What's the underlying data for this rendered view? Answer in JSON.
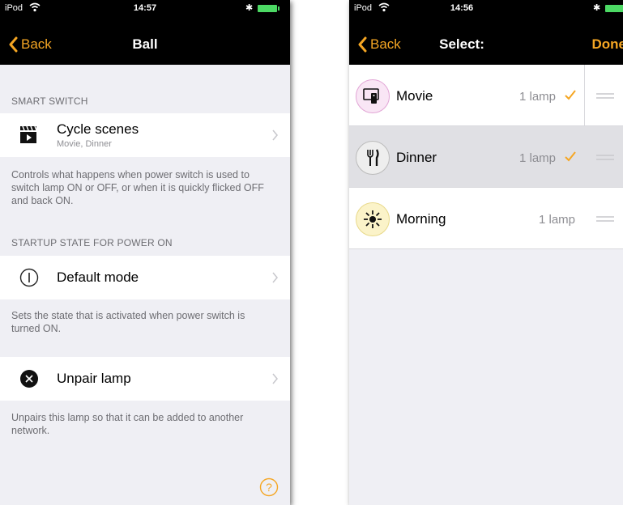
{
  "left_screen": {
    "status": {
      "carrier": "iPod",
      "time": "14:57"
    },
    "nav": {
      "back_label": "Back",
      "title": "Ball"
    },
    "smart_switch": {
      "header": "SMART SWITCH",
      "title": "Cycle scenes",
      "subtitle": "Movie, Dinner",
      "footer": "Controls what happens when power switch is used to switch lamp ON or OFF, or when it is quickly flicked OFF and back ON."
    },
    "startup": {
      "header": "STARTUP STATE FOR POWER ON",
      "title": "Default mode",
      "footer": "Sets the state that is activated when power switch is turned ON."
    },
    "unpair": {
      "title": "Unpair lamp",
      "footer": "Unpairs this lamp so that it can be added to another network."
    },
    "help_icon": "question-circle-icon"
  },
  "right_screen": {
    "status": {
      "carrier": "iPod",
      "time": "14:56"
    },
    "nav": {
      "back_label": "Back",
      "title": "Select:",
      "done_label": "Done"
    },
    "scenes": [
      {
        "name": "Movie",
        "count": "1 lamp",
        "checked": true,
        "icon": "tv-remote-icon",
        "icon_bg": "#f9e6f5",
        "icon_border": "#e2a6d6"
      },
      {
        "name": "Dinner",
        "count": "1 lamp",
        "checked": true,
        "icon": "fork-knife-icon",
        "icon_bg": "#eeeeee",
        "icon_border": "#bbbbbb"
      },
      {
        "name": "Morning",
        "count": "1 lamp",
        "checked": false,
        "icon": "sun-icon",
        "icon_bg": "#fbf3c9",
        "icon_border": "#e8d98a"
      }
    ]
  },
  "colors": {
    "accent": "#f5a623",
    "battery": "#4cd964",
    "background": "#efeff4"
  }
}
